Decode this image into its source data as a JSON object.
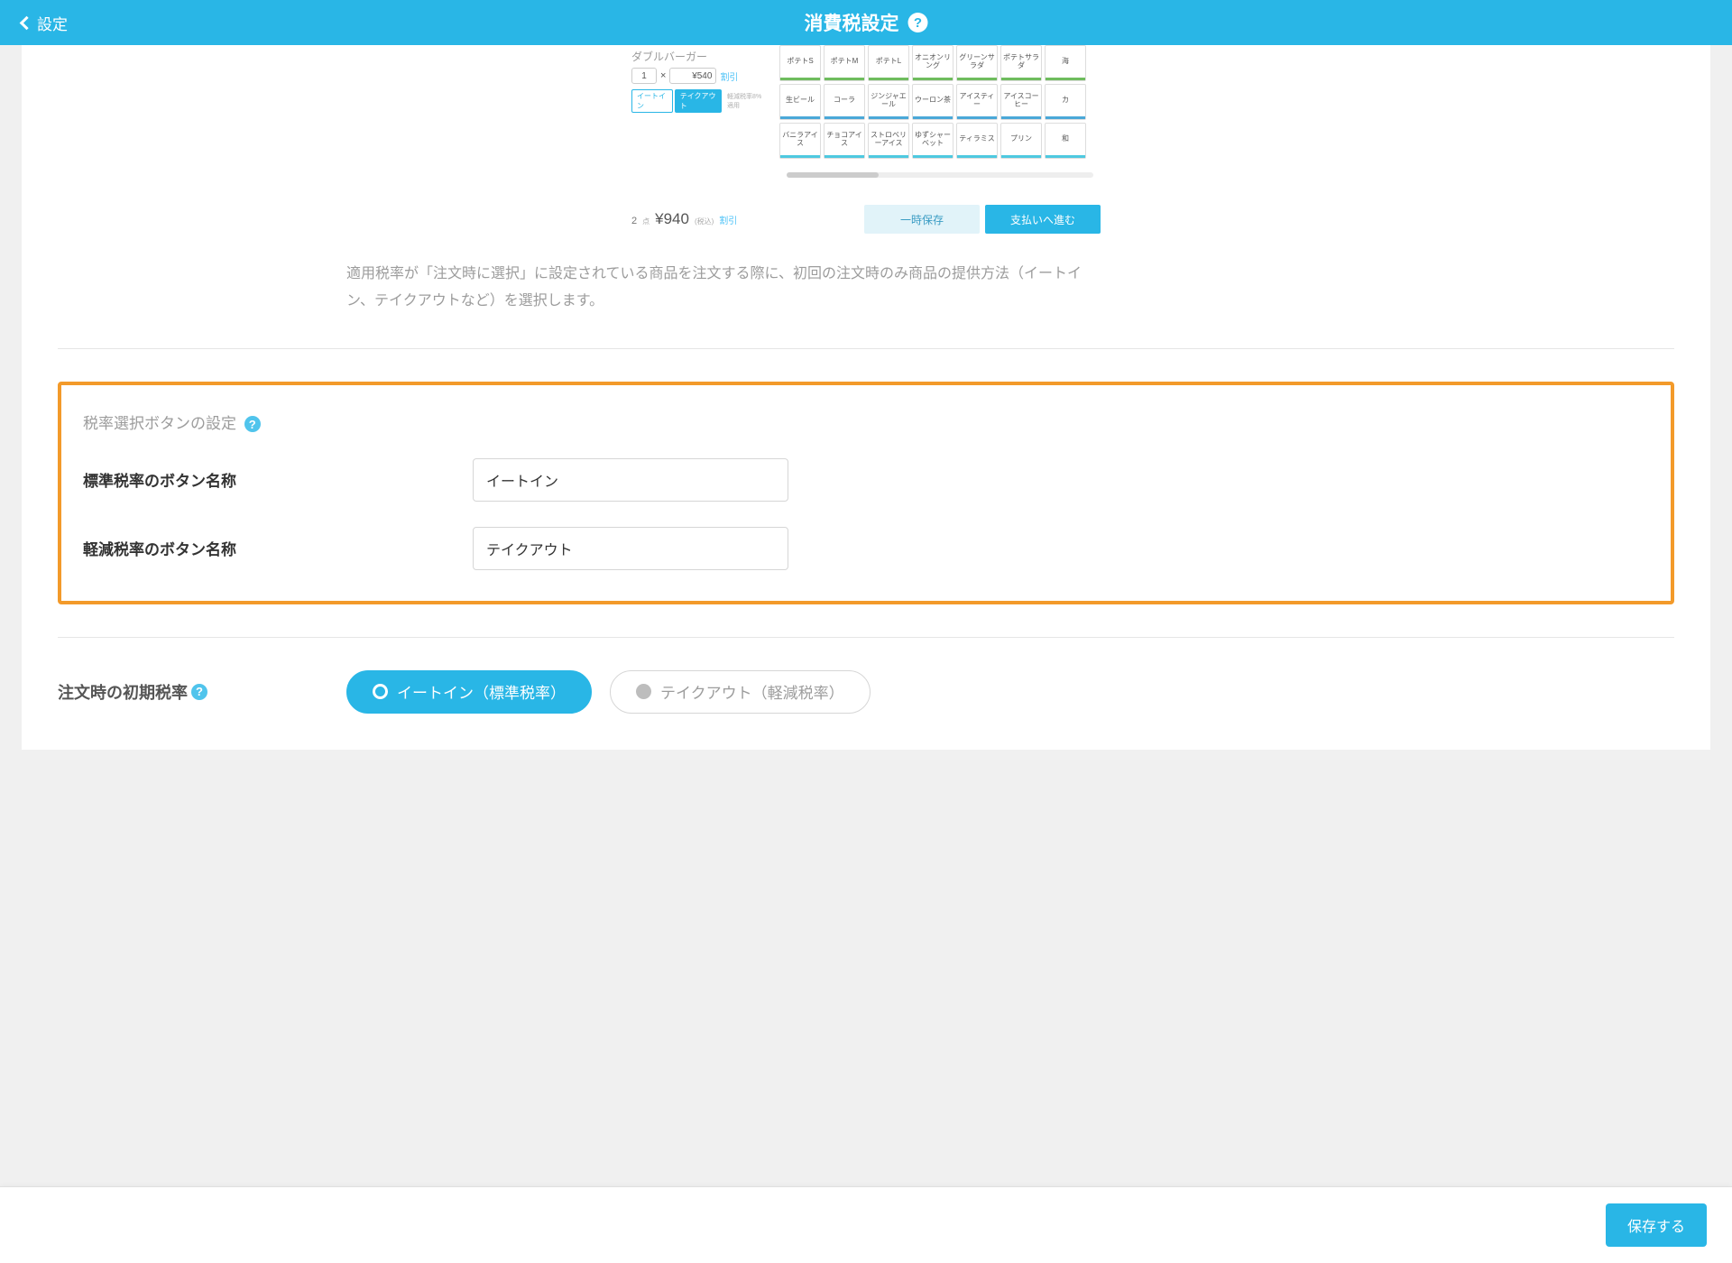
{
  "header": {
    "back_label": "設定",
    "title": "消費税設定"
  },
  "preview": {
    "item_title": "ダブルバーガー",
    "qty": "1",
    "x": "×",
    "price": "¥540",
    "discount": "割引",
    "pill_eatin": "イートイン",
    "pill_takeout": "テイクアウト",
    "pill_note": "軽減税率8%適用",
    "rows": [
      [
        "ポテトS",
        "ポテトM",
        "ポテトL",
        "オニオンリング",
        "グリーンサラダ",
        "ポテトサラダ",
        "海"
      ],
      [
        "生ビール",
        "コーラ",
        "ジンジャエール",
        "ウーロン茶",
        "アイスティー",
        "アイスコーヒー",
        "カ"
      ],
      [
        "バニラアイス",
        "チョコアイス",
        "ストロベリーアイス",
        "ゆずシャーベット",
        "ティラミス",
        "プリン",
        "和"
      ]
    ],
    "total_qty": "2",
    "total_qty_unit": "点",
    "total_price": "¥940",
    "tax_in": "(税込)",
    "total_discount": "割引",
    "btn_save": "一時保存",
    "btn_pay": "支払いへ進む"
  },
  "description": "適用税率が「注文時に選択」に設定されている商品を注文する際に、初回の注文時のみ商品の提供方法（イートイン、テイクアウトなど）を選択します。",
  "highlight": {
    "title": "税率選択ボタンの設定",
    "row1_label": "標準税率のボタン名称",
    "row1_value": "イートイン",
    "row2_label": "軽減税率のボタン名称",
    "row2_value": "テイクアウト"
  },
  "initial_tax": {
    "label": "注文時の初期税率",
    "opt1": "イートイン（標準税率）",
    "opt2": "テイクアウト（軽減税率）"
  },
  "footer": {
    "save": "保存する"
  }
}
